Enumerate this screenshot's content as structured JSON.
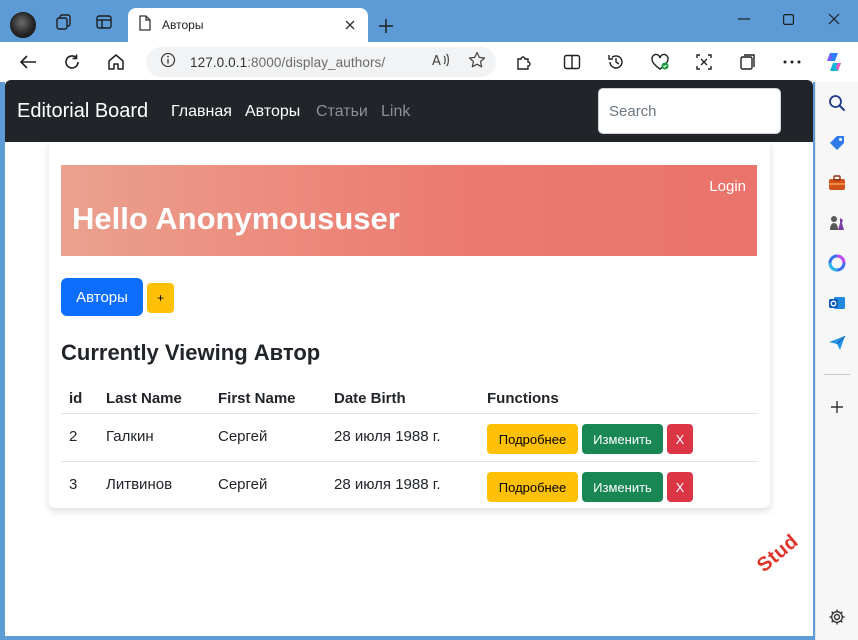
{
  "browser": {
    "tab_title": "Авторы",
    "url_host": "127.0.0.1",
    "url_rest": ":8000/display_authors/"
  },
  "navbar": {
    "brand": "Editorial Board",
    "links": [
      {
        "label": "Главная",
        "color": "#ffffff"
      },
      {
        "label": "Авторы",
        "color": "#ffffff"
      },
      {
        "label": "Статьи",
        "color": "#8c9196"
      },
      {
        "label": "Link",
        "color": "#8c9196"
      }
    ],
    "search_placeholder": "Search"
  },
  "hero": {
    "login_label": "Login",
    "greeting": "Hello Anonymoususer"
  },
  "actions": {
    "authors_button": "Авторы",
    "add_button": "+"
  },
  "section_title": "Currently Viewing Автор",
  "table": {
    "headers": [
      "id",
      "Last Name",
      "First Name",
      "Date Birth",
      "Functions"
    ],
    "rows": [
      {
        "id": "2",
        "last_name": "Галкин",
        "first_name": "Сергей",
        "date_birth": "28 июля 1988 г."
      },
      {
        "id": "3",
        "last_name": "Литвинов",
        "first_name": "Сергей",
        "date_birth": "28 июля 1988 г."
      }
    ],
    "row_buttons": {
      "details": "Подробнее",
      "edit": "Изменить",
      "delete": "X"
    }
  },
  "watermark": "Stud",
  "colors": {
    "primary": "#0d6efd",
    "warning": "#ffc107",
    "success": "#198754",
    "danger": "#dc3545",
    "navbar_bg": "#212529",
    "browser_frame": "#5c9bd6"
  }
}
